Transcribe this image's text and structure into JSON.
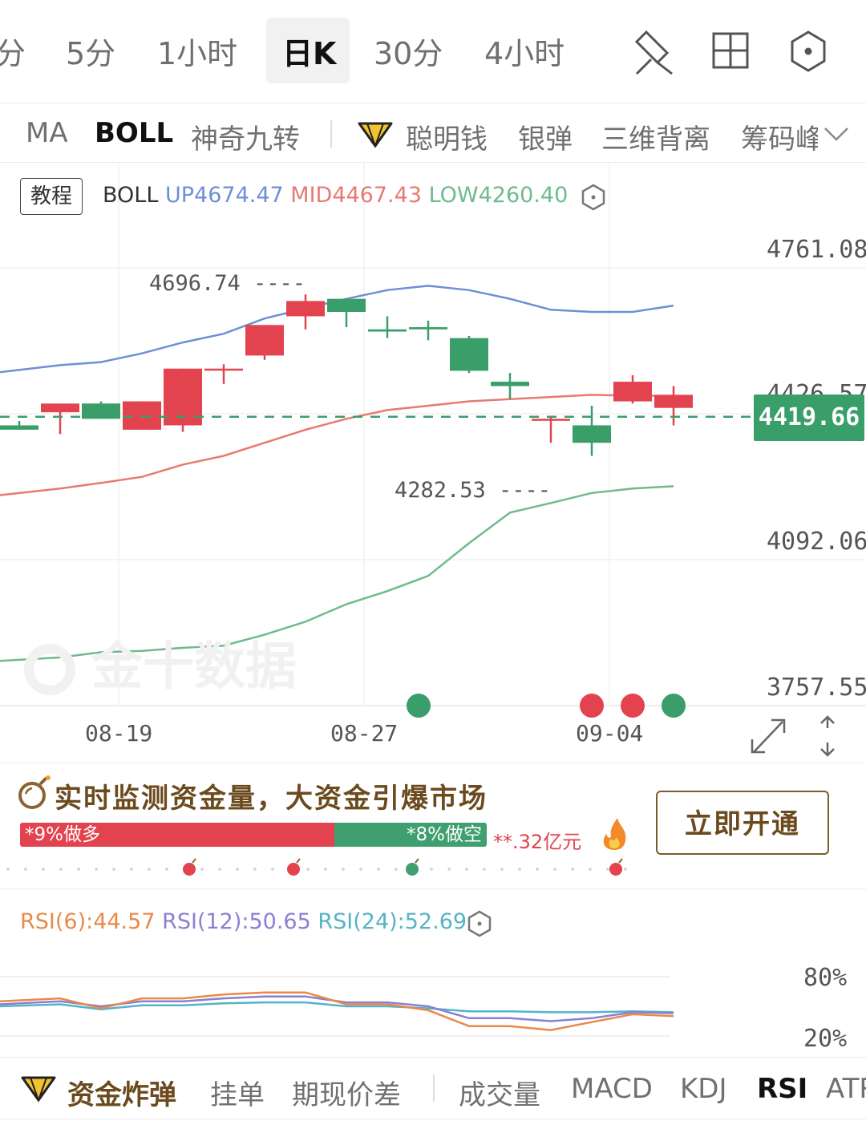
{
  "timeframes": {
    "items": [
      {
        "label": "分"
      },
      {
        "label": "5分"
      },
      {
        "label": "1小时"
      },
      {
        "label": "日K"
      },
      {
        "label": "30分"
      },
      {
        "label": "4小时"
      }
    ],
    "active_index": 3
  },
  "toolbar_icons": [
    "draw-tool-icon",
    "layout-grid-icon",
    "settings-hexagon-icon"
  ],
  "indicators": {
    "items": [
      {
        "label": "MA"
      },
      {
        "label": "BOLL"
      },
      {
        "label": "神奇九转"
      },
      {
        "label": "聪明钱"
      },
      {
        "label": "银弹"
      },
      {
        "label": "三维背离"
      },
      {
        "label": "筹码峰"
      }
    ],
    "active": "BOLL"
  },
  "chart": {
    "tutorial_label": "教程",
    "legend": {
      "name": "BOLL",
      "up": "UP4674.47",
      "mid": "MID4467.43",
      "low": "LOW4260.40"
    },
    "y_ticks": [
      "4761.08",
      "4426.57",
      "4092.06",
      "3757.55"
    ],
    "x_ticks": [
      "08-19",
      "08-27",
      "09-04"
    ],
    "current_price": "4419.66",
    "high_label": "4696.74 ----",
    "low_label": "4282.53 ----",
    "watermark": "金十数据",
    "colors": {
      "up_band": "#6f8fd6",
      "mid_band": "#e77a72",
      "low_band": "#6fbb8c",
      "bull": "#e2434f",
      "bear": "#3a9e6a",
      "price_line": "#3a9e6a"
    }
  },
  "chart_data": {
    "type": "candlestick",
    "x": [
      "08-13",
      "08-14",
      "08-15",
      "08-16",
      "08-19",
      "08-20",
      "08-21",
      "08-22",
      "08-23",
      "08-26",
      "08-27",
      "08-28",
      "08-29",
      "08-30",
      "09-02",
      "09-03",
      "09-04"
    ],
    "open": [
      4400,
      4430,
      4450,
      4390,
      4400,
      4530,
      4560,
      4650,
      4690,
      4620,
      4625,
      4600,
      4500,
      4415,
      4400,
      4455,
      4440
    ],
    "high": [
      4410,
      4440,
      4455,
      4455,
      4530,
      4540,
      4630,
      4700,
      4680,
      4650,
      4640,
      4605,
      4520,
      4420,
      4445,
      4515,
      4490
    ],
    "low": [
      4390,
      4380,
      4415,
      4390,
      4385,
      4495,
      4550,
      4620,
      4625,
      4600,
      4595,
      4520,
      4460,
      4360,
      4330,
      4450,
      4400
    ],
    "close": [
      4390,
      4450,
      4415,
      4455,
      4530,
      4530,
      4630,
      4685,
      4660,
      4615,
      4620,
      4525,
      4490,
      4415,
      4360,
      4500,
      4470
    ],
    "boll_up": [
      4522,
      4538,
      4545,
      4565,
      4590,
      4610,
      4645,
      4668,
      4690,
      4710,
      4720,
      4710,
      4690,
      4665,
      4660,
      4660,
      4674.47
    ],
    "boll_mid": [
      4240,
      4255,
      4268,
      4282,
      4310,
      4330,
      4360,
      4390,
      4415,
      4435,
      4445,
      4455,
      4460,
      4465,
      4470,
      4468,
      4467.43
    ],
    "boll_low": [
      3860,
      3868,
      3880,
      3883,
      3890,
      3895,
      3920,
      3950,
      3990,
      4020,
      4055,
      4130,
      4200,
      4222,
      4245,
      4255,
      4260.4
    ],
    "ylim": [
      3757.55,
      4761.08
    ],
    "signals": [
      {
        "x": "08-27",
        "type": "bear"
      },
      {
        "x": "09-02",
        "type": "bull"
      },
      {
        "x": "09-03",
        "type": "bull"
      },
      {
        "x": "09-04",
        "type": "bear"
      }
    ],
    "current_price": 4419.66
  },
  "promo": {
    "title": "实时监测资金量，大资金引爆市场",
    "long_label": "*9%做多",
    "short_label": "*8%做空",
    "amount": "**.32亿元",
    "long_fraction": 0.67,
    "button": "立即开通"
  },
  "rsi": {
    "rsi6": "RSI(6):44.57",
    "rsi12": "RSI(12):50.65",
    "rsi24": "RSI(24):52.69",
    "y_ticks": [
      "80%",
      "20%"
    ],
    "colors": {
      "rsi6": "#e88a4a",
      "rsi12": "#8c7fd3",
      "rsi24": "#55b3c8"
    },
    "series": {
      "rsi6": [
        55,
        58,
        48,
        58,
        58,
        62,
        64,
        64,
        52,
        52,
        46,
        30,
        30,
        26,
        34,
        42,
        40
      ],
      "rsi12": [
        52,
        55,
        50,
        55,
        55,
        58,
        60,
        60,
        54,
        54,
        50,
        38,
        38,
        35,
        38,
        44,
        43
      ],
      "rsi24": [
        50,
        52,
        47,
        51,
        51,
        53,
        54,
        54,
        50,
        50,
        48,
        45,
        45,
        44,
        44,
        45,
        44
      ]
    }
  },
  "bottom_tabs": {
    "items": [
      {
        "label": "资金炸弹"
      },
      {
        "label": "挂单"
      },
      {
        "label": "期现价差"
      },
      {
        "label": "成交量"
      },
      {
        "label": "MACD"
      },
      {
        "label": "KDJ"
      },
      {
        "label": "RSI"
      },
      {
        "label": "ATR"
      }
    ],
    "active": "RSI"
  }
}
